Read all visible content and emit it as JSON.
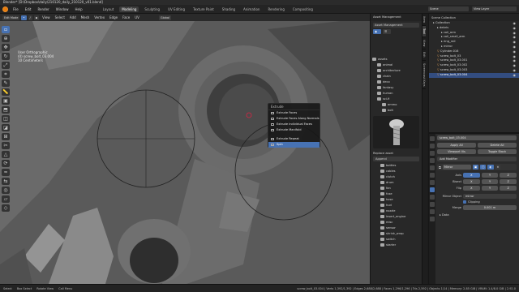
{
  "window_title": "Blender* [D:\\Dropbox\\daily\\210120_daily_210120_v01.blend]",
  "menu": [
    "File",
    "Edit",
    "Render",
    "Window",
    "Help"
  ],
  "workspaces": [
    "Layout",
    "Modeling",
    "Sculpting",
    "UV Editing",
    "Texture Paint",
    "Shading",
    "Animation",
    "Rendering",
    "Compositing"
  ],
  "active_workspace": "Modeling",
  "scene_label": "Scene",
  "view_layer": "View Layer",
  "viewport_header": {
    "mode": "Edit Mode",
    "menus": [
      "View",
      "Select",
      "Add",
      "Mesh",
      "Vertex",
      "Edge",
      "Face",
      "UV"
    ],
    "transform": "Global"
  },
  "overlay": {
    "line1": "User Orthographic",
    "line2": "(0) screw_bolt_03.004",
    "line3": "10 Centimeters"
  },
  "context_menu": {
    "title": "Extrude",
    "items": [
      "Extrude Faces",
      "Extrude Faces Along Normals",
      "Extrude Individual Faces",
      "Extrude Manifold",
      "Extrude Repeat",
      "Spin"
    ],
    "selected": "Spin"
  },
  "asset_browser": {
    "title": "Asset Management",
    "tabs": [
      "Asset Management"
    ],
    "root": "assets",
    "folders": [
      "animal",
      "architecture",
      "chain",
      "deco",
      "fantasy",
      "human",
      "sci-fi"
    ],
    "subitems": [
      "ammo",
      "bolt"
    ],
    "search_label": "Replace asset",
    "append_label": "Append",
    "list": [
      "bottles",
      "cables",
      "clutch",
      "drum",
      "fan",
      "fuse",
      "hose",
      "hud",
      "nozzle",
      "insert_engine",
      "misc",
      "sensor",
      "shrink_wrap",
      "switch",
      "starter"
    ]
  },
  "side_tabs": [
    "Item",
    "Tool",
    "View",
    "Edit",
    "Screencast Keys"
  ],
  "outliner": {
    "header": "Scene Collection",
    "rows": [
      {
        "label": "Collection",
        "indent": 1
      },
      {
        "label": "debris",
        "indent": 2
      },
      {
        "label": "coil_arm",
        "indent": 3
      },
      {
        "label": "coil_small_arm",
        "indent": 3
      },
      {
        "label": "ring_rail",
        "indent": 3
      },
      {
        "label": "mirror",
        "indent": 3
      },
      {
        "label": "Cylinder.016",
        "indent": 2
      },
      {
        "label": "screw_bolt_03",
        "indent": 2
      },
      {
        "label": "screw_bolt_03.001",
        "indent": 2
      },
      {
        "label": "screw_bolt_03.002",
        "indent": 2
      },
      {
        "label": "screw_bolt_03.003",
        "indent": 2
      },
      {
        "label": "screw_bolt_03.004",
        "indent": 2
      }
    ],
    "selected": "screw_bolt_03.004"
  },
  "properties": {
    "object": "screw_bolt_03.004",
    "apply_all": "Apply All",
    "delete_all": "Delete All",
    "viewport_vis": "Viewport Vis",
    "toggle_stack": "Toggle Stack",
    "add_modifier": "Add Modifier",
    "modifier_name": "Mirror",
    "axis_label": "Axis",
    "bisect_label": "Bisect",
    "flip_label": "Flip",
    "axes": [
      "X",
      "Y",
      "Z"
    ],
    "mirror_object_label": "Mirror Object",
    "mirror_object_value": "mirror",
    "clipping_label": "Clipping",
    "merge_label": "Merge",
    "merge_value": "0.001 m",
    "data_label": "Data",
    "side_tabs": [
      "Tool",
      "Render",
      "Output",
      "View Layer",
      "Scene",
      "World",
      "Object",
      "Modifiers",
      "Particles",
      "Physics",
      "Constraints",
      "Data"
    ]
  },
  "status": {
    "select": "Select",
    "box_select": "Box Select",
    "rotate": "Rotate View",
    "call_menu": "Call Menu",
    "stats": "screw_bolt_03.004 | Verts 1,392/1,392 | Edges 2,688/2,688 | Faces 1,296/1,296 | Tris 2,592 | Objects 1/14 | Memory: 2.85 GiB | VRAM: 1.4/8.0 GiB | 2.92.0"
  },
  "colors": {
    "accent": "#4772b3",
    "selection": "#334d80",
    "orange": "#e87d0d",
    "bg": "#5a5a5a"
  }
}
